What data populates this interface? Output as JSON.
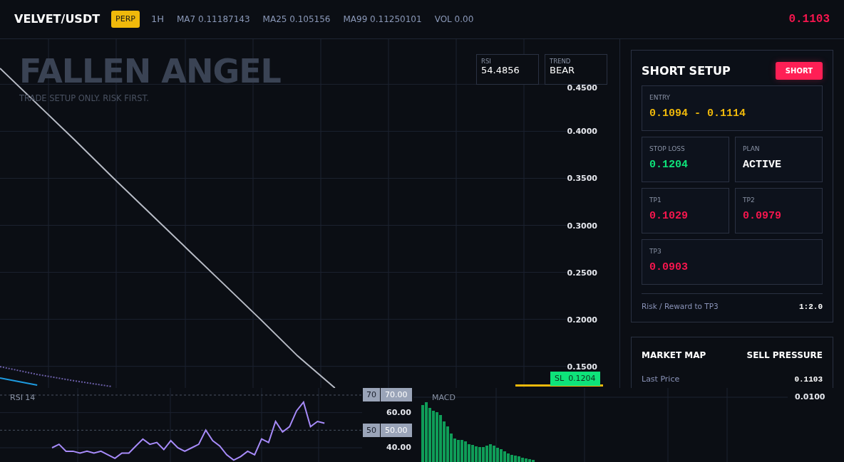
{
  "header": {
    "symbol": "VELVET/USDT",
    "badge": "PERP",
    "timeframe": "1H",
    "indicators": [
      "MA7 0.11187143",
      "MA25 0.105156",
      "MA99 0.11250101",
      "VOL 0.00"
    ],
    "price": "0.1103"
  },
  "chart": {
    "brand": "FALLEN ANGEL",
    "tagline": "TRADE SETUP ONLY. RISK FIRST.",
    "stats": [
      {
        "label": "RSI",
        "value": "54.4856"
      },
      {
        "label": "TREND",
        "value": "BEAR"
      }
    ],
    "price_tag": {
      "label": "SL",
      "value": "0.1204"
    },
    "chart_data": {
      "type": "line",
      "grid": true,
      "ylim": [
        0.127,
        0.498
      ],
      "yticks": [
        {
          "value": 0.45,
          "label": "0.4500"
        },
        {
          "value": 0.4,
          "label": "0.4000"
        },
        {
          "value": 0.35,
          "label": "0.3500"
        },
        {
          "value": 0.3,
          "label": "0.3000"
        },
        {
          "value": 0.25,
          "label": "0.2500"
        },
        {
          "value": 0.2,
          "label": "0.2000"
        },
        {
          "value": 0.15,
          "label": "0.1500"
        }
      ],
      "series": [
        {
          "color": "#b8bcc6",
          "line_style": "solid",
          "values": [
            0.467,
            0.429,
            0.391,
            0.352,
            0.314,
            0.276,
            0.238,
            0.2,
            0.161,
            0.127
          ]
        },
        {
          "color": "#6b5fa8",
          "line_style": "dashed",
          "values": [
            0.1497,
            0.1414,
            0.1346,
            0.1285,
            null,
            null,
            null,
            null,
            null,
            null
          ]
        },
        {
          "color": "#1e9be0",
          "line_style": "solid",
          "values": [
            0.1376,
            0.13,
            null,
            null,
            null,
            null,
            null,
            null,
            null,
            null
          ]
        }
      ]
    }
  },
  "rsi": {
    "title": "RSI 14",
    "level_tags": [
      "70",
      "50"
    ],
    "chart_data": {
      "type": "line",
      "grid": true,
      "ylim": [
        31.9,
        74.05
      ],
      "yticks": [
        {
          "value": 70,
          "label": "70.00"
        },
        {
          "value": 60,
          "label": "60.00"
        },
        {
          "value": 50,
          "label": "50.00"
        },
        {
          "value": 40,
          "label": "40.00"
        }
      ],
      "series": [
        {
          "color": "#a78bfa",
          "line_style": "solid",
          "values": [
            40,
            42,
            38,
            38,
            37,
            38,
            37,
            38,
            36,
            34,
            37,
            37,
            41,
            45,
            42,
            43,
            39,
            44,
            40,
            38,
            40,
            42,
            50,
            44,
            41,
            36,
            33,
            35,
            38,
            36,
            45,
            43,
            55,
            49,
            52,
            61,
            66,
            52,
            55,
            54
          ]
        }
      ]
    }
  },
  "macd": {
    "title": "MACD",
    "axis_label": "0.0100"
  },
  "setup": {
    "title": "SHORT SETUP",
    "side": "SHORT",
    "cells": [
      {
        "kind": "wide",
        "label": "ENTRY",
        "value": "0.1094 - 0.1114",
        "color": "#f0b90b"
      },
      {
        "kind": "half",
        "label": "STOP LOSS",
        "value": "0.1204",
        "color": "#0ee37a"
      },
      {
        "kind": "half",
        "label": "PLAN",
        "value": "ACTIVE",
        "color": "#ffffff"
      },
      {
        "kind": "half",
        "label": "TP1",
        "value": "0.1029",
        "color": "#f6164e"
      },
      {
        "kind": "half",
        "label": "TP2",
        "value": "0.0979",
        "color": "#f6164e"
      },
      {
        "kind": "wide",
        "label": "TP3",
        "value": "0.0903",
        "color": "#f6164e"
      }
    ],
    "risk_reward": {
      "label": "Risk / Reward to TP3",
      "value": "1:2.0"
    }
  },
  "market_map": {
    "title": "MARKET MAP",
    "bias": "SELL PRESSURE",
    "rows": [
      {
        "label": "Last Price",
        "value": "0.1103"
      }
    ]
  }
}
